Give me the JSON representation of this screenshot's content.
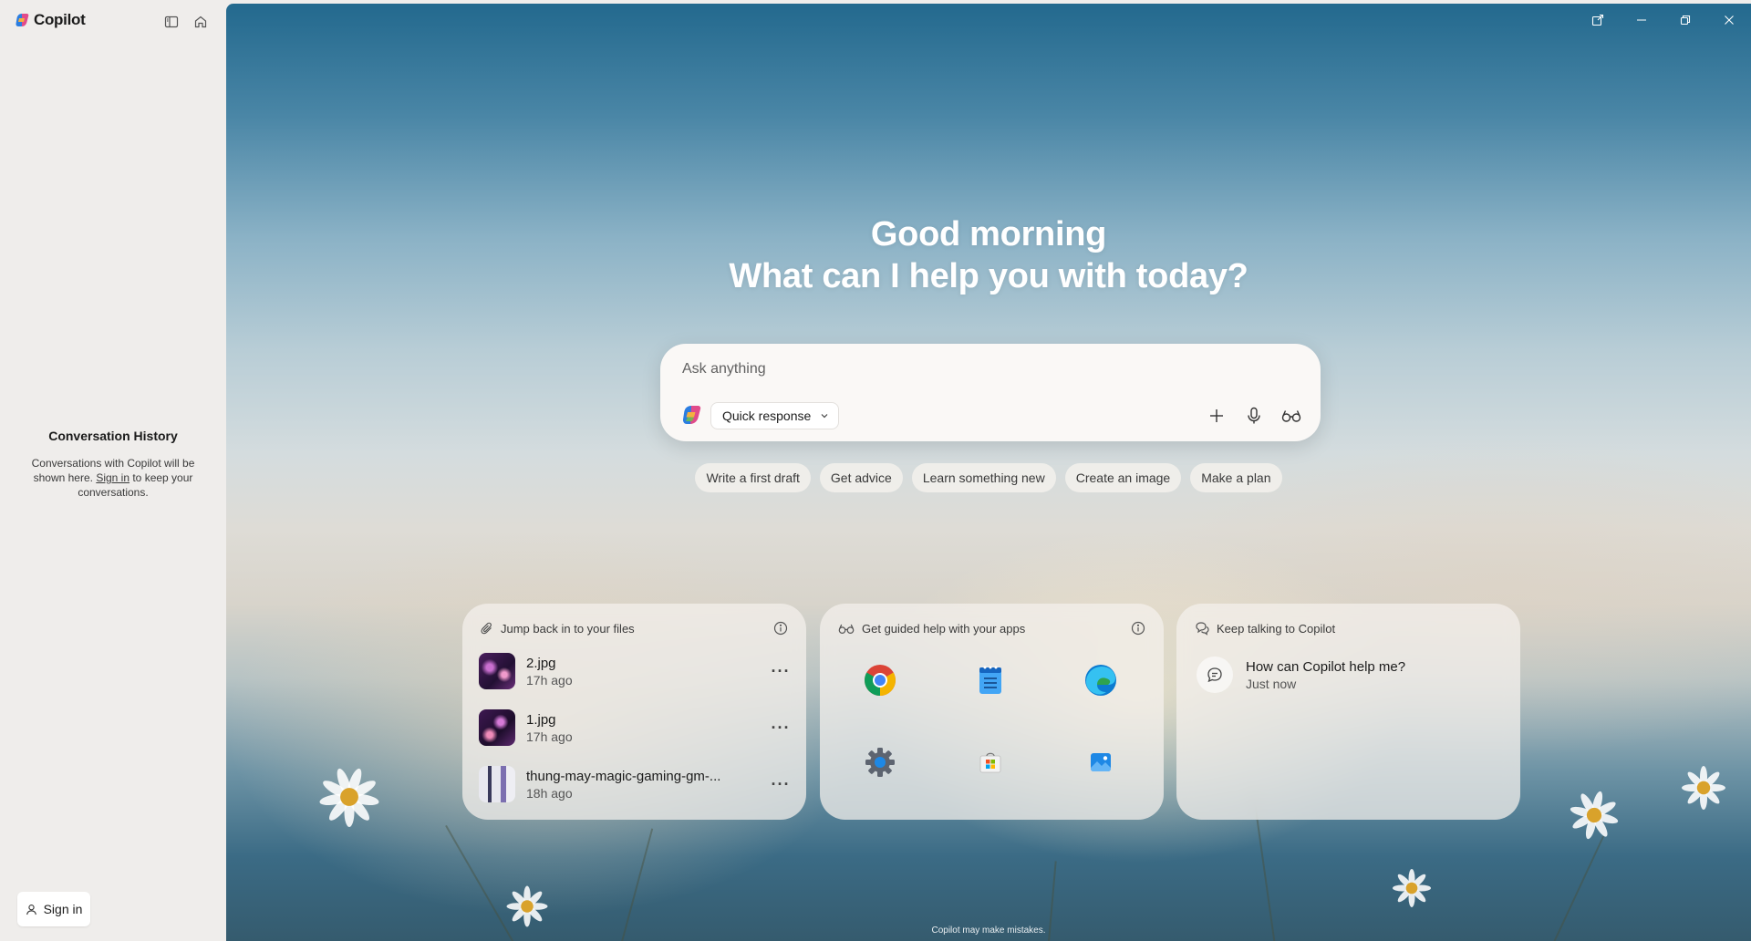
{
  "app": {
    "name": "Copilot"
  },
  "sidebar": {
    "toggle_icon": "sidebar-toggle-icon",
    "home_icon": "home-icon",
    "history_title": "Conversation History",
    "history_text_before": "Conversations with Copilot will be shown here. ",
    "history_link": "Sign in",
    "history_text_after": " to keep your conversations.",
    "signin_label": "Sign in"
  },
  "window": {
    "controls": [
      "pop-out-icon",
      "minimize-icon",
      "restore-icon",
      "close-icon"
    ]
  },
  "greeting": {
    "line1": "Good morning",
    "line2": "What can I help you with today?"
  },
  "composer": {
    "placeholder": "Ask anything",
    "mode": "Quick response"
  },
  "suggestions": [
    "Write a first draft",
    "Get advice",
    "Learn something new",
    "Create an image",
    "Make a plan"
  ],
  "cards": {
    "files": {
      "title": "Jump back in to your files",
      "items": [
        {
          "name": "2.jpg",
          "time": "17h ago"
        },
        {
          "name": "1.jpg",
          "time": "17h ago"
        },
        {
          "name": "thung-may-magic-gaming-gm-...",
          "time": "18h ago"
        }
      ]
    },
    "apps": {
      "title": "Get guided help with your apps",
      "items": [
        "chrome-icon",
        "notepad-icon",
        "edge-icon",
        "settings-icon",
        "store-icon",
        "photos-icon"
      ]
    },
    "convos": {
      "title": "Keep talking to Copilot",
      "items": [
        {
          "title": "How can Copilot help me?",
          "time": "Just now"
        }
      ]
    }
  },
  "footer": {
    "disclaimer": "Copilot may make mistakes."
  },
  "colors": {
    "accent_text": "#1b1b1b",
    "card_bg": "#f4f0ec",
    "sky_top": "#23698e"
  }
}
